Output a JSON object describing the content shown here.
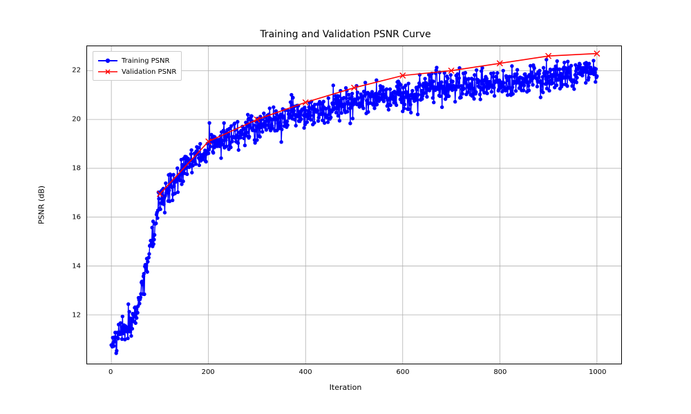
{
  "chart_data": {
    "type": "line",
    "title": "Training and Validation PSNR Curve",
    "xlabel": "Iteration",
    "ylabel": "PSNR (dB)",
    "xlim": [
      -50,
      1050
    ],
    "ylim": [
      10.0,
      23.0
    ],
    "xticks": [
      0,
      200,
      400,
      600,
      800,
      1000
    ],
    "yticks": [
      12,
      14,
      16,
      18,
      20,
      22
    ],
    "grid": true,
    "legend_position": "upper left",
    "series": [
      {
        "name": "Training PSNR",
        "color": "#0000ff",
        "style": "line+markers",
        "marker": "circle",
        "note": "Dense noisy curve (1000 points) following log growth; representative mean values sampled every 50 iterations.",
        "x": [
          0,
          50,
          100,
          150,
          200,
          250,
          300,
          350,
          400,
          450,
          500,
          550,
          600,
          650,
          700,
          750,
          800,
          850,
          900,
          950,
          1000
        ],
        "values": [
          10.7,
          12.0,
          16.6,
          18.0,
          18.8,
          19.3,
          19.7,
          20.0,
          20.3,
          20.5,
          20.7,
          20.9,
          21.0,
          21.2,
          21.3,
          21.4,
          21.5,
          21.6,
          21.7,
          21.8,
          21.9
        ],
        "noise_sigma": 0.3
      },
      {
        "name": "Validation PSNR",
        "color": "#ff0000",
        "style": "line+markers",
        "marker": "x",
        "x": [
          100,
          200,
          300,
          400,
          500,
          600,
          700,
          800,
          900,
          1000
        ],
        "values": [
          16.95,
          19.1,
          20.0,
          20.7,
          21.3,
          21.8,
          22.0,
          22.3,
          22.6,
          22.7
        ]
      }
    ]
  }
}
